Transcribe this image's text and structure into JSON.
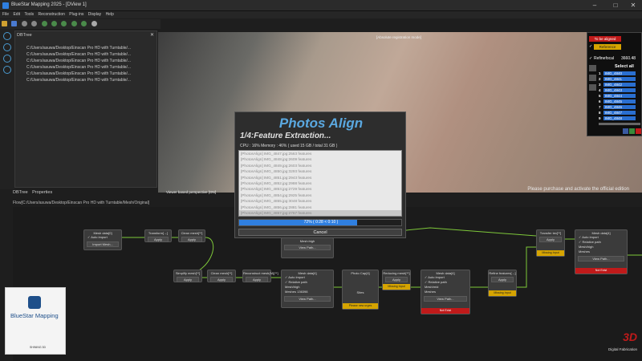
{
  "window": {
    "title": "BlueStar Mapping 2025 - [DView 1]",
    "minimize": "–",
    "maximize": "□",
    "close": "✕"
  },
  "menu": [
    "File",
    "Edit",
    "Tools",
    "Reconstruction",
    "Plug-ins",
    "Display",
    "Help"
  ],
  "dbtree": {
    "title": "DBTree",
    "rows": [
      "C:/Users/asuwa/Desktop/Einscan Pro HD with Turntable/...",
      "C:/Users/asuwa/Desktop/Einscan Pro HD with Turntable/...",
      "C:/Users/asuwa/Desktop/Einscan Pro HD with Turntable/...",
      "C:/Users/asuwa/Desktop/Einscan Pro HD with Turntable/...",
      "C:/Users/asuwa/Desktop/Einscan Pro HD with Turntable/...",
      "C:/Users/asuwa/Desktop/Einscan Pro HD with Turntable/..."
    ]
  },
  "viewport": {
    "top_label": "[Absolute registration mode]",
    "bottom_label": "Viewer based perspective [ON]",
    "purchase": "Please purchase and activate the official edition"
  },
  "camera_panel": {
    "to_be_aligned": "To be aligned",
    "reference": "Reference",
    "refine_focal": "Refinefocal",
    "focal_value": "3660.48",
    "select_all": "Select all",
    "cameras": [
      {
        "num": "1",
        "name": "IMG_4840"
      },
      {
        "num": "2",
        "name": "IMG_4841"
      },
      {
        "num": "3",
        "name": "IMG_4842"
      },
      {
        "num": "4",
        "name": "IMG_4843"
      },
      {
        "num": "5",
        "name": "IMG_4844"
      },
      {
        "num": "6",
        "name": "IMG_4845"
      },
      {
        "num": "7",
        "name": "IMG_4846"
      },
      {
        "num": "8",
        "name": "IMG_4847"
      },
      {
        "num": "9",
        "name": "IMG_4848"
      }
    ]
  },
  "dialog": {
    "title": "Photos Align",
    "step": "1/4:Feature Extraction...",
    "memory": "CPU : 16%  Memory : 46% ( used 15 GB / total 31 GB )",
    "log": [
      "[PhotosAlign] IMG_4847.jpg:2563 features",
      "[PhotosAlign] IMG_4848.jpg:2609 features",
      "[PhotosAlign] IMG_4849.jpg:2603 features",
      "[PhotosAlign] IMG_4850.jpg:3293 features",
      "[PhotosAlign] IMG_4851.jpg:2943 features",
      "[PhotosAlign] IMG_4852.jpg:2988 features",
      "[PhotosAlign] IMG_4853.jpg:2729 features",
      "[PhotosAlign] IMG_4854.jpg:2925 features",
      "[PhotosAlign] IMG_4855.jpg:3048 features",
      "[PhotosAlign] IMG_4856.jpg:2881 features",
      "[PhotosAlign] IMG_4857.jpg:2767 features"
    ],
    "progress": 0.72,
    "progress_text": "72% ( 0:28 < 0:10 )",
    "cancel": "Cancel"
  },
  "flow": {
    "tabs": [
      "DBTree",
      "Properties"
    ],
    "path": "Flow[C:/Users/asuwa/Desktop/Einscan Pro HD with Turntable/Mesh/Original]",
    "nodes": {
      "mesh_data_in": {
        "title": "Mesh data[0]",
        "line1": "Auto import",
        "btn": "Import Mesh..."
      },
      "transform": {
        "title": "Transform[→]",
        "btn": "Apply"
      },
      "clean_mesh1": {
        "title": "Clean mesh[**]",
        "btn": "Apply"
      },
      "simplify": {
        "title": "Simplify mesh[**]",
        "btn": "Apply"
      },
      "clean_mesh2": {
        "title": "Clean mesh[**]",
        "btn": "Apply"
      },
      "reconstruct": {
        "title": "Reconstruct mesh(M)[**]",
        "btn": "Apply"
      },
      "mesh_high": {
        "title": "Mesh:high",
        "btn": "View Path..."
      },
      "mesh_data_mid": {
        "title": "Mesh data[4]",
        "line1": "Auto import",
        "line2": "Relative path",
        "field": "Mesh/high",
        "meshes": "Meshes 136398",
        "btn": "View Path..."
      },
      "photo_capture": {
        "title": "Photo Cap[4]",
        "sub": "Sites",
        "foot": "Please new urges"
      },
      "reducing": {
        "title": "Reducing mesh[**]",
        "btn": "Apply",
        "foot": "Missing Input"
      },
      "mesh_data_mid2": {
        "title": "Mesh data[4]",
        "line1": "Auto import",
        "line2": "Relative path",
        "field": "Mesh/mid",
        "meshes": "Meshes",
        "btn": "View Path...",
        "foot": "Not Exist"
      },
      "refine": {
        "title": "Refine features[→]",
        "btn": "Apply",
        "foot": "Missing Input"
      },
      "transfer": {
        "title": "Transfer tex[**]",
        "btn": "Apply",
        "foot": "Missing Input"
      },
      "mesh_data_out": {
        "title": "Mesh data[4]",
        "line1": "Auto import",
        "line2": "Relative path",
        "field": "Mesh/high",
        "meshes": "Meshes",
        "btn": "View Path...",
        "foot": "Not Exist"
      }
    }
  },
  "branding": {
    "product": "BlueStar Mapping",
    "box_small": "SHINING 3D",
    "logo3d": "3D",
    "logo_sub": "Digital Fabrication"
  },
  "colors": {
    "accent_blue": "#2f7fe0",
    "title_blue": "#5aa8e0",
    "alert_red": "#c01a1a",
    "warn_yellow": "#d6a400",
    "wire_green": "#7ec83a"
  }
}
